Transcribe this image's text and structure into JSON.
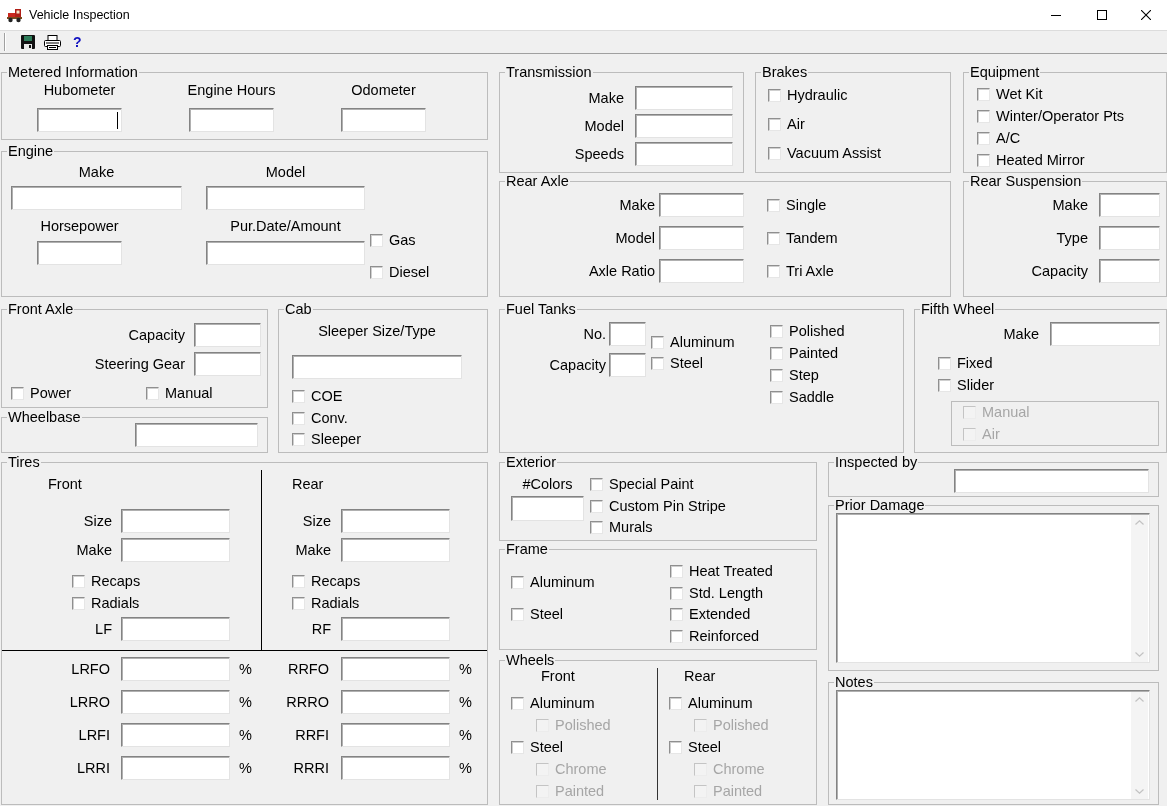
{
  "window": {
    "title": "Vehicle Inspection"
  },
  "toolbar": {
    "help_label": "?"
  },
  "metered_information": {
    "title": "Metered Information",
    "fields": [
      {
        "label": "Hubometer",
        "focused": true
      },
      {
        "label": "Engine Hours",
        "focused": false
      },
      {
        "label": "Odometer",
        "focused": false
      }
    ]
  },
  "transmission": {
    "title": "Transmission",
    "fields": [
      {
        "label": "Make"
      },
      {
        "label": "Model"
      },
      {
        "label": "Speeds"
      }
    ]
  },
  "brakes": {
    "title": "Brakes",
    "options": [
      {
        "label": "Hydraulic",
        "checked": false
      },
      {
        "label": "Air",
        "checked": false
      },
      {
        "label": "Vacuum Assist",
        "checked": false
      }
    ]
  },
  "equipment": {
    "title": "Equipment",
    "options": [
      {
        "label": "Wet Kit",
        "checked": false
      },
      {
        "label": "Winter/Operator Pts",
        "checked": false
      },
      {
        "label": "A/C",
        "checked": false
      },
      {
        "label": "Heated Mirror",
        "checked": false
      }
    ]
  },
  "engine": {
    "title": "Engine",
    "fields": [
      {
        "label": "Make"
      },
      {
        "label": "Model"
      },
      {
        "label": "Horsepower"
      },
      {
        "label": "Pur.Date/Amount"
      }
    ],
    "fuel_types": [
      {
        "label": "Gas",
        "checked": false
      },
      {
        "label": "Diesel",
        "checked": false
      }
    ]
  },
  "rear_axle": {
    "title": "Rear Axle",
    "fields": [
      {
        "label": "Make"
      },
      {
        "label": "Model"
      },
      {
        "label": "Axle Ratio"
      }
    ],
    "options": [
      {
        "label": "Single",
        "checked": false
      },
      {
        "label": "Tandem",
        "checked": false
      },
      {
        "label": "Tri Axle",
        "checked": false
      }
    ]
  },
  "rear_suspension": {
    "title": "Rear Suspension",
    "fields": [
      {
        "label": "Make"
      },
      {
        "label": "Type"
      },
      {
        "label": "Capacity"
      }
    ]
  },
  "front_axle": {
    "title": "Front Axle",
    "fields": [
      {
        "label": "Capacity"
      },
      {
        "label": "Steering Gear"
      }
    ],
    "options": [
      {
        "label": "Power",
        "checked": false
      },
      {
        "label": "Manual",
        "checked": false
      }
    ]
  },
  "cab": {
    "title": "Cab",
    "field": {
      "label": "Sleeper Size/Type"
    },
    "options": [
      {
        "label": "COE",
        "checked": false
      },
      {
        "label": "Conv.",
        "checked": false
      },
      {
        "label": "Sleeper",
        "checked": false
      }
    ]
  },
  "fuel_tanks": {
    "title": "Fuel Tanks",
    "fields": [
      {
        "label": "No."
      },
      {
        "label": "Capacity"
      }
    ],
    "materials": [
      {
        "label": "Aluminum",
        "checked": false
      },
      {
        "label": "Steel",
        "checked": false
      }
    ],
    "options": [
      {
        "label": "Polished",
        "checked": false
      },
      {
        "label": "Painted",
        "checked": false
      },
      {
        "label": "Step",
        "checked": false
      },
      {
        "label": "Saddle",
        "checked": false
      }
    ]
  },
  "fifth_wheel": {
    "title": "Fifth Wheel",
    "field": {
      "label": "Make"
    },
    "options": [
      {
        "label": "Fixed",
        "checked": false,
        "disabled": false
      },
      {
        "label": "Slider",
        "checked": false,
        "disabled": false,
        "children": [
          {
            "label": "Manual",
            "checked": false,
            "disabled": true
          },
          {
            "label": "Air",
            "checked": false,
            "disabled": true
          }
        ]
      }
    ]
  },
  "wheelbase": {
    "title": "Wheelbase"
  },
  "tires": {
    "title": "Tires",
    "sides": [
      {
        "heading": "Front",
        "fields": [
          {
            "label": "Size"
          },
          {
            "label": "Make"
          }
        ],
        "options": [
          {
            "label": "Recaps",
            "checked": false
          },
          {
            "label": "Radials",
            "checked": false
          }
        ],
        "position_field": {
          "label": "LF"
        }
      },
      {
        "heading": "Rear",
        "fields": [
          {
            "label": "Size"
          },
          {
            "label": "Make"
          }
        ],
        "options": [
          {
            "label": "Recaps",
            "checked": false
          },
          {
            "label": "Radials",
            "checked": false
          }
        ],
        "position_field": {
          "label": "RF"
        }
      }
    ],
    "tread_depths": [
      {
        "label": "LRFO",
        "unit": "%"
      },
      {
        "label": "RRFO",
        "unit": "%"
      },
      {
        "label": "LRRO",
        "unit": "%"
      },
      {
        "label": "RRRO",
        "unit": "%"
      },
      {
        "label": "LRFI",
        "unit": "%"
      },
      {
        "label": "RRFI",
        "unit": "%"
      },
      {
        "label": "LRRI",
        "unit": "%"
      },
      {
        "label": "RRRI",
        "unit": "%"
      }
    ]
  },
  "exterior": {
    "title": "Exterior",
    "field": {
      "label": "#Colors"
    },
    "options": [
      {
        "label": "Special Paint",
        "checked": false
      },
      {
        "label": "Custom Pin Stripe",
        "checked": false
      },
      {
        "label": "Murals",
        "checked": false
      }
    ]
  },
  "inspected_by": {
    "title": "Inspected by"
  },
  "frame": {
    "title": "Frame",
    "materials": [
      {
        "label": "Aluminum",
        "checked": false
      },
      {
        "label": "Steel",
        "checked": false
      }
    ],
    "options": [
      {
        "label": "Heat Treated",
        "checked": false
      },
      {
        "label": "Std. Length",
        "checked": false
      },
      {
        "label": "Extended",
        "checked": false
      },
      {
        "label": "Reinforced",
        "checked": false
      }
    ]
  },
  "prior_damage": {
    "title": "Prior Damage"
  },
  "wheels": {
    "title": "Wheels",
    "sides": [
      {
        "heading": "Front",
        "options": [
          {
            "label": "Aluminum",
            "checked": false,
            "disabled": false,
            "children": [
              {
                "label": "Polished",
                "checked": false,
                "disabled": true
              }
            ]
          },
          {
            "label": "Steel",
            "checked": false,
            "disabled": false,
            "children": [
              {
                "label": "Chrome",
                "checked": false,
                "disabled": true
              },
              {
                "label": "Painted",
                "checked": false,
                "disabled": true
              }
            ]
          }
        ]
      },
      {
        "heading": "Rear",
        "options": [
          {
            "label": "Aluminum",
            "checked": false,
            "disabled": false,
            "children": [
              {
                "label": "Polished",
                "checked": false,
                "disabled": true
              }
            ]
          },
          {
            "label": "Steel",
            "checked": false,
            "disabled": false,
            "children": [
              {
                "label": "Chrome",
                "checked": false,
                "disabled": true
              },
              {
                "label": "Painted",
                "checked": false,
                "disabled": true
              }
            ]
          }
        ]
      }
    ]
  },
  "notes": {
    "title": "Notes"
  }
}
